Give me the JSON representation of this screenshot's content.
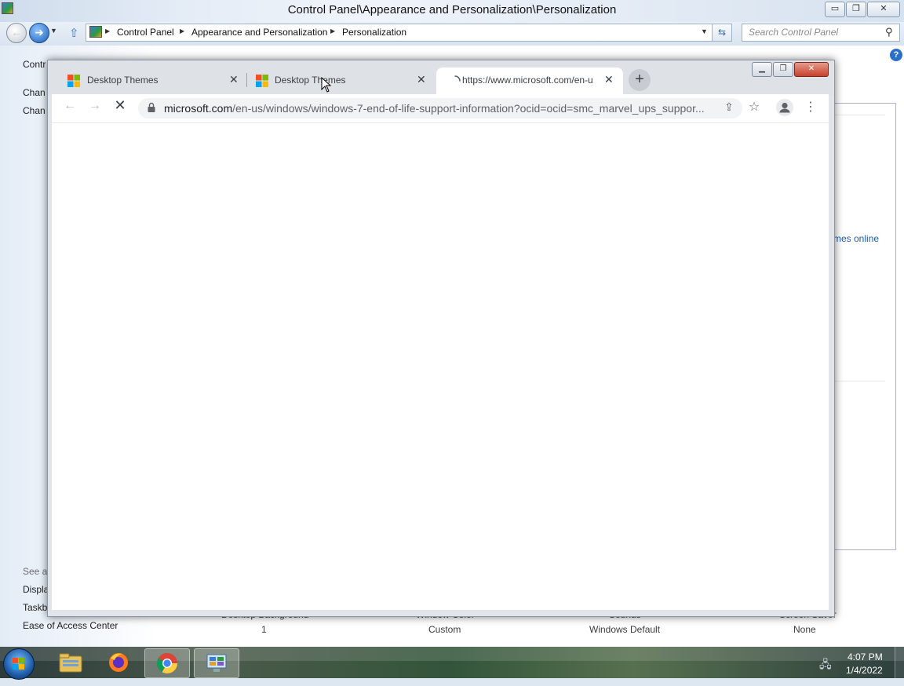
{
  "control_panel": {
    "title": "Control Panel\\Appearance and Personalization\\Personalization",
    "window_controls": {
      "minimize": "▭",
      "maximize": "❐",
      "close": "✕"
    },
    "breadcrumb": [
      "Control Panel",
      "Appearance and Personalization",
      "Personalization"
    ],
    "search_placeholder": "Search Control Panel",
    "sidebar_partial": {
      "home": "Contr",
      "link1": "Chan",
      "link2": "Chan",
      "see_also": "See al",
      "display": "Displa",
      "taskbar": "Taskb",
      "ease": "Ease of Access Center"
    },
    "themes_online_partial": "mes online",
    "bottom_items": [
      {
        "caption": "Desktop Background",
        "value": "1"
      },
      {
        "caption": "Window Color",
        "value": "Custom"
      },
      {
        "caption": "Sounds",
        "value": "Windows Default"
      },
      {
        "caption": "Screen Saver",
        "value": "None"
      }
    ]
  },
  "browser": {
    "tabs": [
      {
        "title": "Desktop Themes",
        "active": false
      },
      {
        "title": "Desktop Themes",
        "active": false
      },
      {
        "title": "https://www.microsoft.com/en-u",
        "active": true
      }
    ],
    "url_host": "microsoft.com",
    "url_path": "/en-us/windows/windows-7-end-of-life-support-information?ocid=ocid=smc_marvel_ups_suppor...",
    "loading": true
  },
  "taskbar": {
    "apps": [
      "Windows Explorer",
      "Firefox",
      "Google Chrome",
      "Control Panel"
    ],
    "active_app": "Google Chrome",
    "time": "4:07 PM",
    "date": "1/4/2022"
  },
  "colors": {
    "link_blue": "#1a5fb4",
    "chrome_tabstrip": "#dee1e6",
    "close_red": "#c6402c"
  }
}
